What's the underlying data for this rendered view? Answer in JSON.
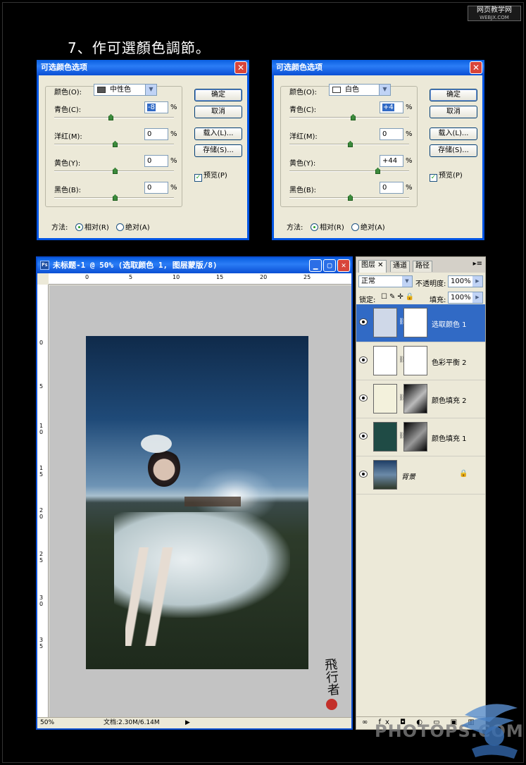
{
  "step_title": "7、作可選顏色調節。",
  "site_logo": {
    "name": "网页教学网",
    "url": "WEBJX.COM"
  },
  "dialog_left": {
    "title": "可选颜色选项",
    "colors_label": "颜色(O):",
    "colors_value": "中性色",
    "colors_swatch": "#555555",
    "sliders": [
      {
        "label": "青色(C):",
        "value": "-8",
        "level": -8
      },
      {
        "label": "洋红(M):",
        "value": "0",
        "level": 0
      },
      {
        "label": "黄色(Y):",
        "value": "0",
        "level": 0
      },
      {
        "label": "黑色(B):",
        "value": "0",
        "level": 0
      }
    ],
    "pct": "%",
    "buttons": [
      "确定",
      "取消",
      "载入(L)...",
      "存储(S)..."
    ],
    "preview": "预览(P)",
    "method_label": "方法:",
    "method_relative": "相对(R)",
    "method_absolute": "绝对(A)"
  },
  "dialog_right": {
    "title": "可选颜色选项",
    "colors_label": "颜色(O):",
    "colors_value": "白色",
    "colors_swatch": "#ffffff",
    "sliders": [
      {
        "label": "青色(C):",
        "value": "+4",
        "level": 4
      },
      {
        "label": "洋红(M):",
        "value": "0",
        "level": 0
      },
      {
        "label": "黄色(Y):",
        "value": "+44",
        "level": 44
      },
      {
        "label": "黑色(B):",
        "value": "0",
        "level": 0
      }
    ],
    "pct": "%",
    "buttons": [
      "确定",
      "取消",
      "载入(L)...",
      "存储(S)..."
    ],
    "preview": "预览(P)",
    "method_label": "方法:",
    "method_relative": "相对(R)",
    "method_absolute": "绝对(A)"
  },
  "doc_window": {
    "title": "未标题-1 @ 50% (选取颜色 1, 图层蒙版/8)",
    "ps_icon": "Ps",
    "ruler_h": [
      "0",
      "5",
      "10",
      "15",
      "20",
      "25"
    ],
    "ruler_v": [
      "0",
      "5",
      "1 0",
      "1 5",
      "2 0",
      "2 5",
      "3 0",
      "3 5"
    ],
    "zoom": "50%",
    "doc_size": "文档:2.30M/6.14M"
  },
  "layers_panel": {
    "tabs": [
      "图层",
      "通道",
      "路径"
    ],
    "blend_mode": "正常",
    "opacity_label": "不透明度:",
    "opacity": "100%",
    "lock_label": "锁定:",
    "fill_label": "填充:",
    "fill": "100%",
    "layers": [
      {
        "name": "选取颜色 1",
        "selected": true,
        "thumb": "#ffffff"
      },
      {
        "name": "色彩平衡 2",
        "selected": false,
        "thumb": "#ffffff"
      },
      {
        "name": "颜色填充 2",
        "selected": false,
        "thumb": "#f3f1dc"
      },
      {
        "name": "颜色填充 1",
        "selected": false,
        "thumb": "#1f4b45"
      },
      {
        "name": "背景",
        "selected": false,
        "thumb": "#2a4a6c"
      }
    ],
    "footer_icons": "∞ fx ◘ ◐ ▭ ▣ ▥"
  },
  "watermark": "PHOTOPS.COM",
  "signature": "飛行者"
}
